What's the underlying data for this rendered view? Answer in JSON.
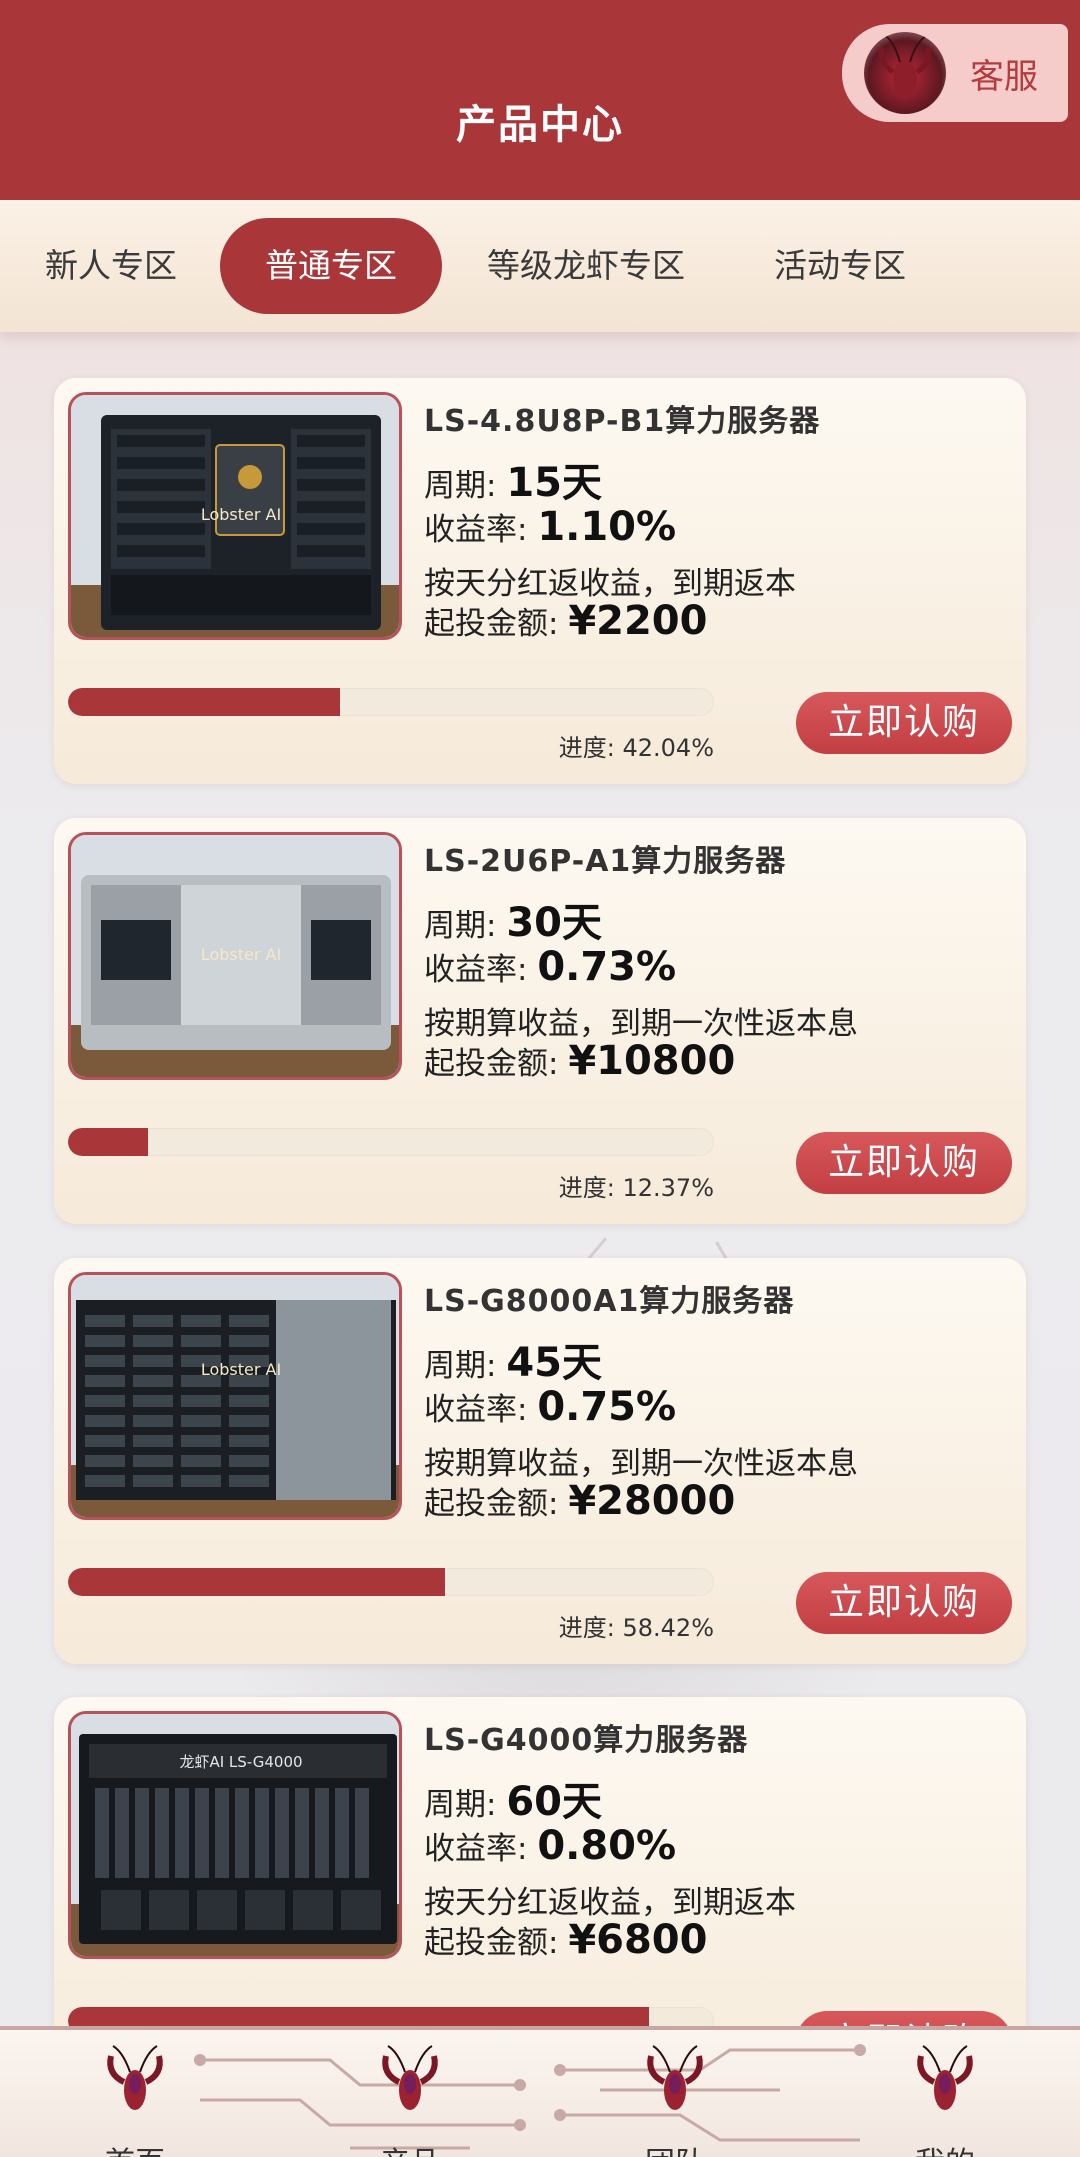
{
  "header": {
    "title": "产品中心",
    "service_label": "客服"
  },
  "tabs": [
    {
      "label": "新人专区",
      "active": false
    },
    {
      "label": "普通专区",
      "active": true
    },
    {
      "label": "等级龙虾专区",
      "active": false
    },
    {
      "label": "活动专区",
      "active": false
    }
  ],
  "labels": {
    "period": "周期: ",
    "yield": "收益率: ",
    "min_invest": "起投金额: ",
    "progress_prefix": "进度: ",
    "buy": "立即认购"
  },
  "products": [
    {
      "name": "LS-4.8U8P-B1算力服务器",
      "period": "15天",
      "yield": "1.10%",
      "payout": "按天分红返收益，到期返本",
      "min_invest": "¥2200",
      "progress": 42.04,
      "progress_text": "42.04%",
      "image_text": "Lobster AI",
      "image_style": "dark"
    },
    {
      "name": "LS-2U6P-A1算力服务器",
      "period": "30天",
      "yield": "0.73%",
      "payout": "按期算收益，到期一次性返本息",
      "min_invest": "¥10800",
      "progress": 12.37,
      "progress_text": "12.37%",
      "image_text": "Lobster AI",
      "image_style": "silver"
    },
    {
      "name": "LS-G8000A1算力服务器",
      "period": "45天",
      "yield": "0.75%",
      "payout": "按期算收益，到期一次性返本息",
      "min_invest": "¥28000",
      "progress": 58.42,
      "progress_text": "58.42%",
      "image_text": "Lobster AI",
      "image_style": "rack"
    },
    {
      "name": "LS-G4000算力服务器",
      "period": "60天",
      "yield": "0.80%",
      "payout": "按天分红返收益，到期返本",
      "min_invest": "¥6800",
      "progress": 90,
      "progress_text": "",
      "image_text": "龙虾AI  LS-G4000",
      "image_style": "black"
    }
  ],
  "bottom_nav": [
    {
      "label": "首页",
      "icon": "lobster-icon"
    },
    {
      "label": "产品",
      "icon": "lobster-icon"
    },
    {
      "label": "团队",
      "icon": "lobster-icon"
    },
    {
      "label": "我的",
      "icon": "lobster-icon"
    }
  ],
  "colors": {
    "brand": "#a9373a",
    "button": "#c94a4e",
    "card_bg": "#f8eee0"
  }
}
